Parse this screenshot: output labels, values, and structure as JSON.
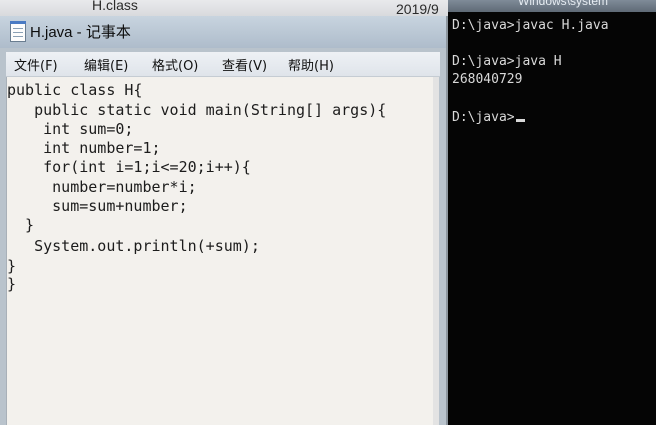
{
  "explorer": {
    "file_name": "H.class",
    "date_partial": "2019/9"
  },
  "notepad": {
    "title": "H.java - 记事本",
    "menu": [
      "文件(F)",
      "编辑(E)",
      "格式(O)",
      "查看(V)",
      "帮助(H)"
    ],
    "code_lines": [
      "public class H{",
      "   public static void main(String[] args){",
      "    int sum=0;",
      "    int number=1;",
      "    for(int i=1;i<=20;i++){",
      "     number=number*i;",
      "     sum=sum+number;",
      "  }",
      "   System.out.println(+sum);",
      "}",
      "}"
    ]
  },
  "console": {
    "title_partial": "Windows\\system",
    "lines": [
      "D:\\java>javac H.java",
      "",
      "D:\\java>java H",
      "268040729",
      "",
      "D:\\java>"
    ]
  },
  "colors": {
    "console_bg": "#050505",
    "console_text": "#d9d9d9",
    "editor_bg": "#f3f1ed"
  }
}
